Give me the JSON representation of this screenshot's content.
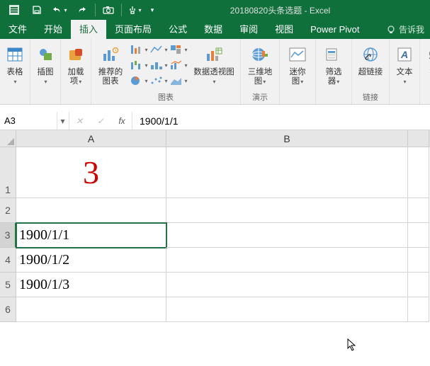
{
  "app": {
    "title": "20180820头条选题 - Excel"
  },
  "tabs": {
    "file": "文件",
    "home": "开始",
    "insert": "插入",
    "layout": "页面布局",
    "formulas": "公式",
    "data": "数据",
    "review": "审阅",
    "view": "视图",
    "powerpivot": "Power Pivot",
    "tell": "告诉我"
  },
  "ribbon": {
    "tables": "表格",
    "illustrations": "插图",
    "addins": "加载\n项",
    "recommended": "推荐的\n图表",
    "charts_label": "图表",
    "pivot_chart": "数据透视图",
    "map3d": "三维地\n图",
    "tours": "演示",
    "sparklines": "迷你图",
    "filters": "筛选器",
    "hyperlink": "超链接",
    "links": "链接",
    "text": "文本",
    "symbols": "符号"
  },
  "formula_bar": {
    "name": "A3",
    "value": "1900/1/1"
  },
  "columns": [
    "A",
    "B"
  ],
  "rows": [
    "1",
    "2",
    "3",
    "4",
    "5",
    "6"
  ],
  "cells": {
    "A1": "3",
    "A3": "1900/1/1",
    "A4": "1900/1/2",
    "A5": "1900/1/3"
  },
  "active_cell": "A3",
  "col_widths": {
    "A": 212,
    "B": 341
  }
}
